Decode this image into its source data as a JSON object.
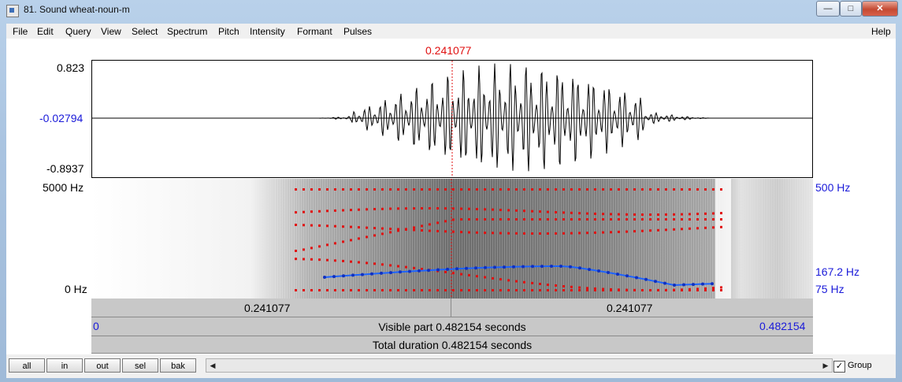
{
  "window": {
    "title": "81. Sound wheat-noun-m",
    "minimize": "—",
    "maximize": "□",
    "close": "✕"
  },
  "menu": {
    "items": [
      "File",
      "Edit",
      "Query",
      "View",
      "Select",
      "Spectrum",
      "Pitch",
      "Intensity",
      "Formant",
      "Pulses"
    ],
    "help": "Help"
  },
  "cursor": {
    "time": "0.241077"
  },
  "waveform": {
    "max": "0.823",
    "zero": "-0.02794",
    "min": "-0.8937"
  },
  "spectrogram": {
    "top_freq": "5000 Hz",
    "bottom_freq": "0 Hz",
    "pitch_top": "500 Hz",
    "pitch_current": "167.2 Hz",
    "pitch_bottom": "75 Hz"
  },
  "selection": {
    "left": "0.241077",
    "right": "0.241077"
  },
  "visible": {
    "start": "0",
    "label": "Visible part 0.482154 seconds",
    "end": "0.482154"
  },
  "total": {
    "label": "Total duration 0.482154 seconds"
  },
  "buttons": {
    "all": "all",
    "in": "in",
    "out": "out",
    "sel": "sel",
    "bak": "bak"
  },
  "group": {
    "label": "Group",
    "checked": true
  },
  "colors": {
    "cursor": "#e01010",
    "axis_blue": "#1a1ad9",
    "pitch": "#1e64ff",
    "formant": "#e01010"
  }
}
